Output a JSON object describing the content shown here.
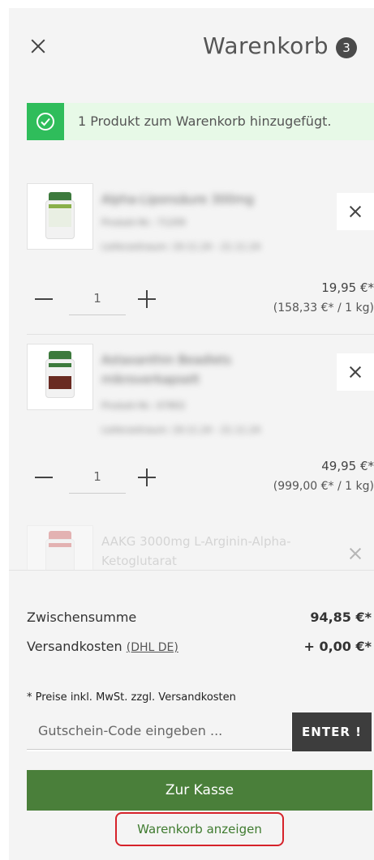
{
  "header": {
    "title": "Warenkorb",
    "count": "3"
  },
  "notice": {
    "text": "1 Produkt zum Warenkorb hinzugefügt."
  },
  "items": [
    {
      "name": "Alpha-Liponsäure 300mg",
      "article": "Produkt-Nr.: 71209",
      "delivery": "Lieferzeitraum: 19.11.24 - 21.11.24",
      "qty": "1",
      "price": "19,95 €*",
      "unit_price": "(158,33 €* / 1 kg)"
    },
    {
      "name": "Astaxanthin Beadlets mikroverkapselt",
      "article": "Produkt-Nr.: 67802",
      "delivery": "Lieferzeitraum: 19.11.24 - 21.11.24",
      "qty": "1",
      "price": "49,95 €*",
      "unit_price": "(999,00 €* / 1 kg)"
    },
    {
      "name": "AAKG 3000mg L-Arginin-Alpha-Ketoglutarat"
    }
  ],
  "summary": {
    "subtotal_label": "Zwischensumme",
    "subtotal_value": "94,85 €*",
    "shipping_label": "Versandkosten",
    "shipping_link": "(DHL DE)",
    "shipping_value": "+ 0,00 €*",
    "note": "* Preise inkl. MwSt. zzgl. Versandkosten"
  },
  "voucher": {
    "placeholder": "Gutschein-Code eingeben ...",
    "button": "ENTER !"
  },
  "actions": {
    "checkout": "Zur Kasse",
    "view_cart": "Warenkorb anzeigen"
  },
  "colors": {
    "accent_green": "#4a7f3a",
    "success_green": "#2fbd5b",
    "highlight_red": "#d6222a"
  }
}
